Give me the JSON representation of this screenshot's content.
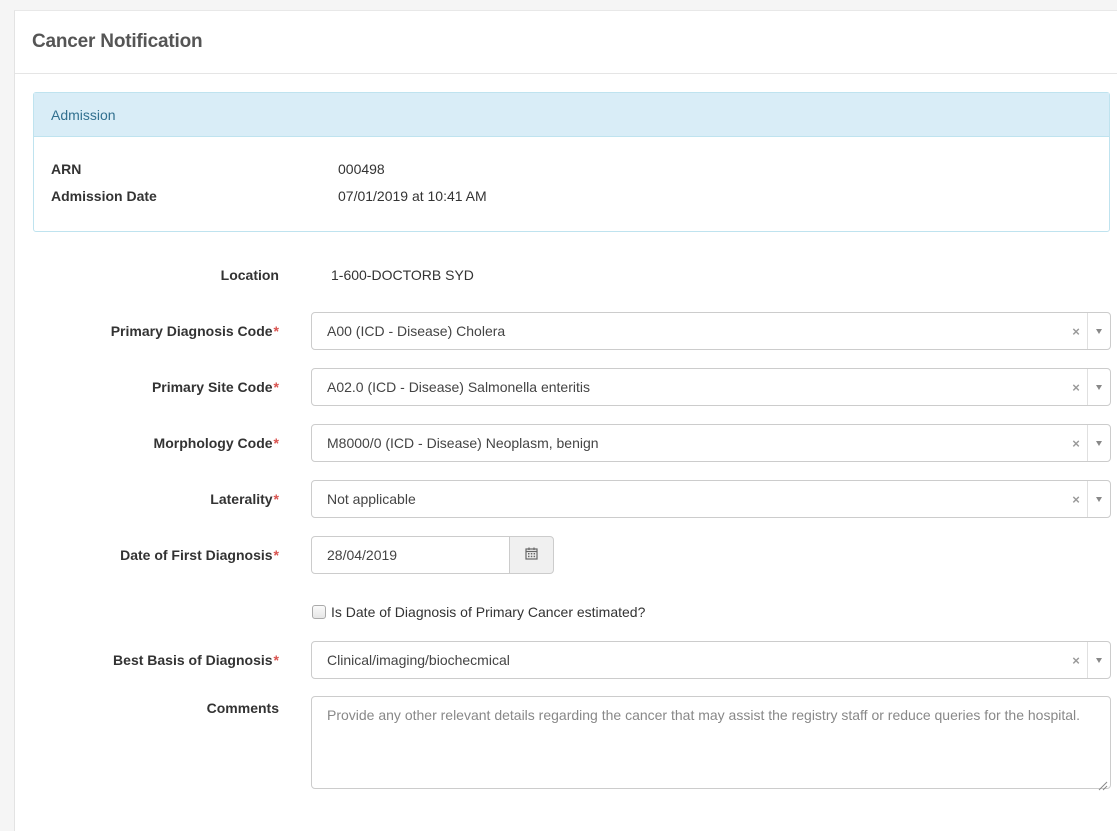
{
  "panel": {
    "title": "Cancer Notification"
  },
  "admission": {
    "heading": "Admission",
    "arn_label": "ARN",
    "arn_value": "000498",
    "date_label": "Admission Date",
    "date_value": "07/01/2019 at 10:41 AM"
  },
  "form": {
    "location": {
      "label": "Location",
      "value": "1-600-DOCTORB SYD"
    },
    "primary_diagnosis": {
      "label": "Primary Diagnosis Code",
      "required_mark": "*",
      "value": "A00 (ICD - Disease) Cholera",
      "clear": "×"
    },
    "primary_site": {
      "label": "Primary Site Code",
      "required_mark": "*",
      "value": "A02.0 (ICD - Disease) Salmonella enteritis",
      "clear": "×"
    },
    "morphology": {
      "label": "Morphology Code",
      "required_mark": "*",
      "value": "M8000/0 (ICD - Disease) Neoplasm, benign",
      "clear": "×"
    },
    "laterality": {
      "label": "Laterality",
      "required_mark": "*",
      "value": "Not applicable",
      "clear": "×"
    },
    "first_diagnosis": {
      "label": "Date of First Diagnosis",
      "required_mark": "*",
      "value": "28/04/2019"
    },
    "estimated": {
      "label": "Is Date of Diagnosis of Primary Cancer estimated?",
      "checked": false
    },
    "best_basis": {
      "label": "Best Basis of Diagnosis",
      "required_mark": "*",
      "value": "Clinical/imaging/biochecmical",
      "clear": "×"
    },
    "comments": {
      "label": "Comments",
      "placeholder": "Provide any other relevant details regarding the cancer that may assist the registry staff or reduce queries for the hospital."
    }
  },
  "icons": {
    "calendar": "calendar-icon",
    "dropdown": "chevron-down-icon",
    "clear": "close-icon",
    "resize": "resize-grip-icon"
  },
  "colors": {
    "required": "#d9534f",
    "admission_header_bg": "#d9edf7",
    "admission_header_text": "#31708f"
  }
}
